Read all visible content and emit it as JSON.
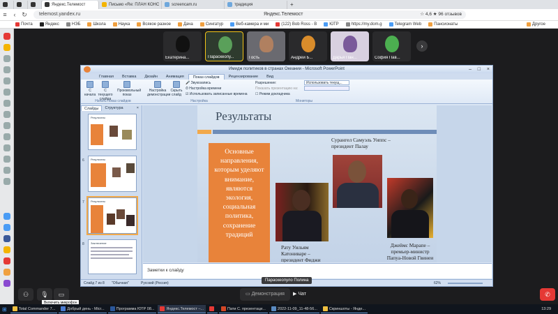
{
  "browser": {
    "tabs": [
      {
        "label": "",
        "color": "#333333"
      },
      {
        "label": "",
        "color": "#333333"
      },
      {
        "label": "Яндекс.Телемост",
        "color": "#333333",
        "active": true
      },
      {
        "label": "Письмо «Re: ПЛАН КОНС",
        "color": "#f4b400"
      },
      {
        "label": "screencam.ru",
        "color": "#6fa8dc"
      },
      {
        "label": "традиция",
        "color": "#6fa8dc"
      }
    ],
    "url": "telemost.yandex.ru",
    "window_title": "Яндекс.Телемост",
    "rating": "☆ 4,6 ★ 96 отзывов",
    "bookmarks": [
      {
        "label": "Почта",
        "color": "#e53935"
      },
      {
        "label": "Яндекс",
        "color": "#222222"
      },
      {
        "label": "НЭБ",
        "color": "#888888"
      },
      {
        "label": "Школа",
        "color": "#f0a040"
      },
      {
        "label": "Наука",
        "color": "#f0a040"
      },
      {
        "label": "Всякое разное",
        "color": "#f0a040"
      },
      {
        "label": "Дача",
        "color": "#f0a040"
      },
      {
        "label": "Сингатур",
        "color": "#f0a040"
      },
      {
        "label": "Веб-камера и ми",
        "color": "#4a9cf5"
      },
      {
        "label": "(122) Bob Ross - B",
        "color": "#e53935"
      },
      {
        "label": "ЮТР",
        "color": "#4a9cf5"
      },
      {
        "label": "https://my.dom.g",
        "color": "#888888"
      },
      {
        "label": "Telegram Web",
        "color": "#4a9cf5"
      },
      {
        "label": "Пансионаты",
        "color": "#f0a040"
      },
      {
        "label": "Другое",
        "color": "#f0a040"
      }
    ]
  },
  "participants": [
    {
      "name": "Екатерина...",
      "bg": "#2a2a2c",
      "face": "#1a1a1a"
    },
    {
      "name": "Параскеопу...",
      "bg": "#2e3b2e",
      "face": "#5aa05a",
      "selected": true
    },
    {
      "name": "Гость",
      "bg": "#6a6a70",
      "face": "#b08060"
    },
    {
      "name": "Андрей Б...",
      "bg": "#2a2a2c",
      "face": "#d98c2b"
    },
    {
      "name": "Дарья Пан...",
      "bg": "#d8d0e0",
      "face": "#7a5a9a"
    },
    {
      "name": "София Пав...",
      "bg": "#2a2a2c",
      "face": "#4caf50"
    }
  ],
  "more_icon": "›",
  "ppt": {
    "title": "Имидж политиков в странах Океании - Microsoft PowerPoint",
    "tabs": [
      "Главная",
      "Вставка",
      "Дизайн",
      "Анимация",
      "Показ слайдов",
      "Рецензирование",
      "Вид"
    ],
    "ribbon": {
      "from_start": "С начала",
      "from_current": "С текущего слайда",
      "custom_show": "Произвольный показ",
      "setup": "Настройка демонстрации",
      "hide": "Скрыть слайд",
      "record": "Звукозапись",
      "rehearse": "Настройка времени",
      "use_timings": "Использовать записанные времена",
      "resolution_label": "Разрешение:",
      "resolution_value": "Использовать текущ...",
      "show_on_label": "Показать презентацию на:",
      "presenter_view": "Режим докладчика",
      "group_start": "Начать показ слайдов",
      "group_setup": "Настройка",
      "group_monitors": "Мониторы"
    },
    "panel_tabs": [
      "Слайды",
      "Структура"
    ],
    "thumbs": [
      {
        "num": "",
        "title": "Результаты"
      },
      {
        "num": "6",
        "title": "Результаты"
      },
      {
        "num": "7",
        "title": "Результаты"
      },
      {
        "num": "8",
        "title": "Заключение"
      }
    ],
    "slide": {
      "title": "Результаты",
      "orange_text": "Основные направления, которым уделяют внимание, являются экология, социальная политика, сохранение традиций",
      "cap_left": "Рату Уильям Катониваре – президент Фиджи",
      "cap_center": "Сурангел Самуэль Уиппс – президент Палау",
      "cap_right": "Джеймс Марапе – премьер-министр Папуа-Новой Гвинеи"
    },
    "notes_placeholder": "Заметки к слайду",
    "status": {
      "slide": "Слайд 7 из 8",
      "theme": "\"Обычная\"",
      "lang": "Русский (Россия)",
      "zoom": "62%"
    }
  },
  "tooltip": "Параскеопуло Полина",
  "mic_tooltip": "Включить микрофон",
  "controls": {
    "demo": "Демонстрация",
    "chat": "Чат"
  },
  "taskbar": {
    "items": [
      {
        "label": "Total Commander 7...",
        "color": "#f0c040"
      },
      {
        "label": "Добрый день - Micr...",
        "color": "#4a7ad0"
      },
      {
        "label": "Программа ЮТР 08...",
        "color": "#2b579a"
      },
      {
        "label": "Яндекс.Телемост –...",
        "color": "#e53935",
        "active": true
      },
      {
        "label": "",
        "color": "#e53935"
      },
      {
        "label": "Пати С. презентаци...",
        "color": "#d24726"
      },
      {
        "label": "2022-11-09_11-48-56...",
        "color": "#5a8ac0"
      },
      {
        "label": "Скриншоты - Янде...",
        "color": "#f0c040"
      }
    ],
    "clock": "13:29"
  }
}
